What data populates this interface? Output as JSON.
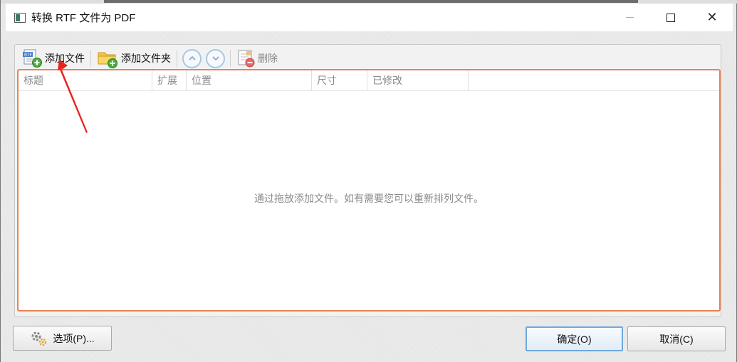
{
  "window": {
    "title": "转换 RTF 文件为 PDF",
    "minimize": "—",
    "close": "✕"
  },
  "toolbar": {
    "add_file": "添加文件",
    "add_folder": "添加文件夹",
    "delete": "删除",
    "icons": [
      "rtf-file-add-icon",
      "folder-add-icon",
      "move-up-icon",
      "move-down-icon",
      "delete-list-icon"
    ]
  },
  "list": {
    "columns": [
      "标题",
      "扩展",
      "位置",
      "尺寸",
      "已修改",
      ""
    ],
    "empty_message": "通过拖放添加文件。如有需要您可以重新排列文件。"
  },
  "buttons": {
    "options": "选项(P)...",
    "ok": "确定(O)",
    "cancel": "取消(C)"
  },
  "colors": {
    "list_border": "#e9824e",
    "ok_border": "#6fa8dc",
    "annotation_arrow": "#e8231f"
  }
}
